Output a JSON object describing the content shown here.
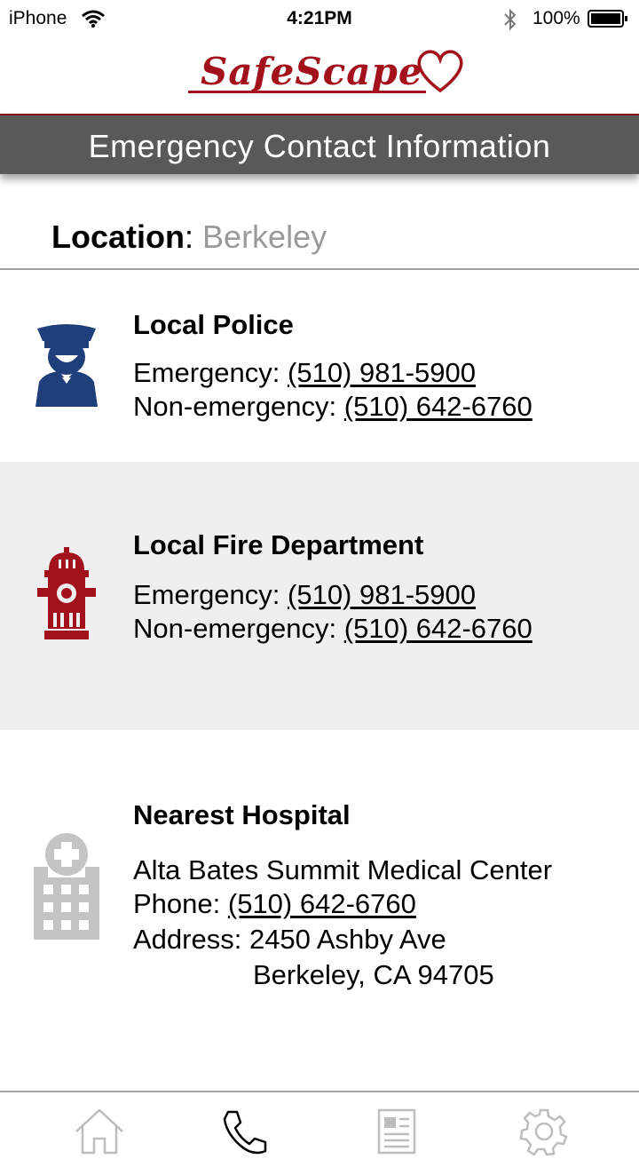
{
  "status_bar": {
    "carrier": "iPhone",
    "time": "4:21PM",
    "battery": "100%"
  },
  "app": {
    "logo_text": "SafeScape",
    "brand_color": "#a3121c"
  },
  "header": {
    "title": "Emergency Contact Information"
  },
  "location": {
    "label": "Location",
    "separator": ":",
    "value": "Berkeley"
  },
  "police": {
    "title": "Local Police",
    "emergency_label": "Emergency: ",
    "emergency_phone": "(510) 981-5900",
    "non_emergency_label": "Non-emergency: ",
    "non_emergency_phone": "(510) 642-6760",
    "icon": "police-officer-icon",
    "icon_color": "#1f3f7a"
  },
  "fire": {
    "title": "Local Fire Department",
    "emergency_label": "Emergency: ",
    "emergency_phone": "(510) 981-5900",
    "non_emergency_label": "Non-emergency: ",
    "non_emergency_phone": "(510) 642-6760",
    "icon": "fire-hydrant-icon",
    "icon_color": "#a3121c"
  },
  "hospital": {
    "title": "Nearest Hospital",
    "name": "Alta Bates Summit Medical Center",
    "phone_label": "Phone: ",
    "phone": "(510) 642-6760",
    "address_label": "Address: ",
    "address_line1": "2450 Ashby Ave",
    "address_line2": "Berkeley, CA 94705",
    "icon": "hospital-building-icon",
    "icon_color": "#c4c4c4"
  },
  "tab_bar": {
    "tabs": [
      {
        "icon": "home-icon",
        "selected": false
      },
      {
        "icon": "phone-icon",
        "selected": true
      },
      {
        "icon": "news-icon",
        "selected": false
      },
      {
        "icon": "settings-icon",
        "selected": false
      }
    ]
  }
}
